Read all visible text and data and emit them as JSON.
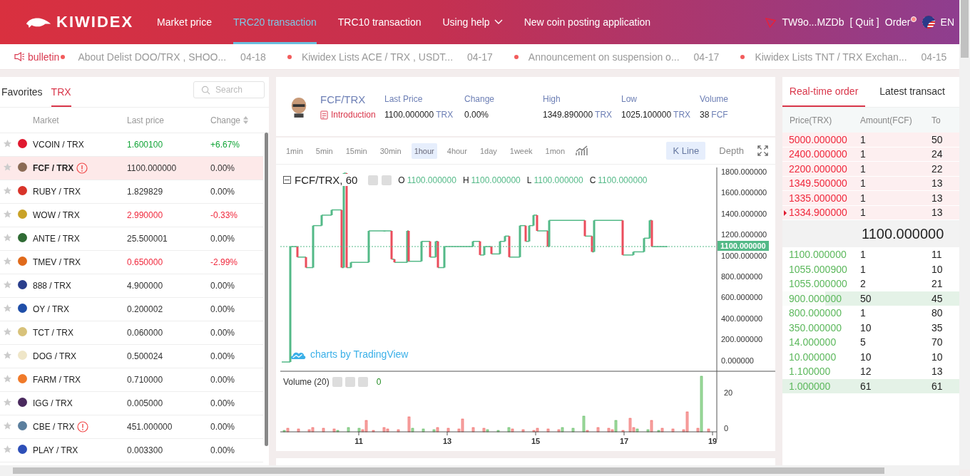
{
  "header": {
    "logo": "KIWIDEX",
    "nav": [
      {
        "label": "Market price",
        "selected": false,
        "dropdown": false
      },
      {
        "label": "TRC20 transaction",
        "selected": true,
        "dropdown": false
      },
      {
        "label": "TRC10 transaction",
        "selected": false,
        "dropdown": false
      },
      {
        "label": "Using help",
        "selected": false,
        "dropdown": true
      },
      {
        "label": "New coin posting application",
        "selected": false,
        "dropdown": false
      }
    ],
    "account": "TW9o...MZDb",
    "quit": "[ Quit ]",
    "order": "Order",
    "language": "EN"
  },
  "ticker": {
    "label": "bulletin",
    "items": [
      {
        "text": "About Delist DOO/TRX , SHOO...",
        "date": "04-18"
      },
      {
        "text": "Kiwidex Lists ACE / TRX , USDT...",
        "date": "04-17"
      },
      {
        "text": "Announcement on suspension o...",
        "date": "04-17"
      },
      {
        "text": "Kiwidex Lists TNT / TRX Exchan...",
        "date": "04-15"
      }
    ]
  },
  "markets": {
    "tabs": [
      {
        "label": "Favorites",
        "selected": false
      },
      {
        "label": "TRX",
        "selected": true
      }
    ],
    "search": {
      "placeholder": "Search"
    },
    "columns": [
      "Market",
      "Last price",
      "Change"
    ],
    "rows": [
      {
        "market": "VCOIN / TRX",
        "price": "1.600100",
        "change": "+6.67%",
        "kind": "up",
        "warning": false,
        "selected": false,
        "color": "#e0192f"
      },
      {
        "market": "FCF / TRX",
        "price": "1100.000000",
        "change": "0.00%",
        "kind": "flat",
        "warning": true,
        "selected": true,
        "color": "#8a6b55"
      },
      {
        "market": "RUBY / TRX",
        "price": "1.829829",
        "change": "0.00%",
        "kind": "flat",
        "warning": false,
        "selected": false,
        "color": "#d8342a"
      },
      {
        "market": "WOW / TRX",
        "price": "2.990000",
        "change": "-0.33%",
        "kind": "down",
        "warning": false,
        "selected": false,
        "color": "#c9a227"
      },
      {
        "market": "ANTE / TRX",
        "price": "25.500001",
        "change": "0.00%",
        "kind": "flat",
        "warning": false,
        "selected": false,
        "color": "#2f6b34"
      },
      {
        "market": "TMEV / TRX",
        "price": "0.650000",
        "change": "-2.99%",
        "kind": "down",
        "warning": false,
        "selected": false,
        "color": "#e06a1b"
      },
      {
        "market": "888 / TRX",
        "price": "4.900000",
        "change": "0.00%",
        "kind": "flat",
        "warning": false,
        "selected": false,
        "color": "#2a3e8c"
      },
      {
        "market": "OY / TRX",
        "price": "0.200002",
        "change": "0.00%",
        "kind": "flat",
        "warning": false,
        "selected": false,
        "color": "#1f4ea8"
      },
      {
        "market": "TCT / TRX",
        "price": "0.060000",
        "change": "0.00%",
        "kind": "flat",
        "warning": false,
        "selected": false,
        "color": "#d8c27a"
      },
      {
        "market": "DOG / TRX",
        "price": "0.500024",
        "change": "0.00%",
        "kind": "flat",
        "warning": false,
        "selected": false,
        "color": "#efe6c8"
      },
      {
        "market": "FARM / TRX",
        "price": "0.710000",
        "change": "0.00%",
        "kind": "flat",
        "warning": false,
        "selected": false,
        "color": "#f07a2a"
      },
      {
        "market": "IGG / TRX",
        "price": "0.005000",
        "change": "0.00%",
        "kind": "flat",
        "warning": false,
        "selected": false,
        "color": "#4a2a5e"
      },
      {
        "market": "CBE / TRX",
        "price": "451.000000",
        "change": "0.00%",
        "kind": "flat",
        "warning": true,
        "selected": false,
        "color": "#5b7f9e"
      },
      {
        "market": "PLAY / TRX",
        "price": "0.003300",
        "change": "0.00%",
        "kind": "flat",
        "warning": false,
        "selected": false,
        "color": "#2d4fb8"
      }
    ]
  },
  "pair": {
    "name": "FCF/TRX",
    "intro": "Introduction",
    "stats": [
      {
        "label": "Last Price",
        "value": "1100.000000",
        "unit": "TRX"
      },
      {
        "label": "Change",
        "value": "0.00%"
      },
      {
        "label": "High",
        "value": "1349.890000",
        "unit": "TRX"
      },
      {
        "label": "Low",
        "value": "1025.100000",
        "unit": "TRX"
      },
      {
        "label": "Volume",
        "value": "38",
        "unit": "FCF"
      }
    ]
  },
  "chart": {
    "intervals": [
      {
        "label": "1min",
        "selected": false
      },
      {
        "label": "5min",
        "selected": false
      },
      {
        "label": "15min",
        "selected": false
      },
      {
        "label": "30min",
        "selected": false
      },
      {
        "label": "1hour",
        "selected": true
      },
      {
        "label": "4hour",
        "selected": false
      },
      {
        "label": "1day",
        "selected": false
      },
      {
        "label": "1week",
        "selected": false
      },
      {
        "label": "1mon",
        "selected": false
      }
    ],
    "views": [
      {
        "label": "K Line",
        "selected": true
      },
      {
        "label": "Depth",
        "selected": false
      }
    ],
    "legend": {
      "title": "FCF/TRX, 60",
      "values": [
        {
          "key": "O",
          "value": "1100.000000"
        },
        {
          "key": "H",
          "value": "1100.000000"
        },
        {
          "key": "L",
          "value": "1100.000000"
        },
        {
          "key": "C",
          "value": "1100.000000"
        }
      ]
    },
    "price_ticks": [
      "1800.000000",
      "1600.000000",
      "1400.000000",
      "1200.000000",
      "1000.000000",
      "800.000000",
      "600.000000",
      "400.000000",
      "200.000000",
      "0.000000"
    ],
    "last_tag": "1100.000000",
    "watermark": "charts by TradingView",
    "volume": {
      "title": "Volume (20)",
      "value": "0",
      "ticks": [
        "20",
        "0"
      ]
    },
    "date_ticks": [
      "11",
      "13",
      "15",
      "17",
      "19"
    ]
  },
  "orderbook": {
    "tabs": [
      {
        "label": "Real-time order",
        "selected": true
      },
      {
        "label": "Latest transact",
        "selected": false
      }
    ],
    "columns": [
      "Price(TRX)",
      "Amount(FCF)",
      "To"
    ],
    "asks": [
      {
        "price": "5000.000000",
        "amount": "1",
        "total": "50",
        "pointer": false
      },
      {
        "price": "2400.000000",
        "amount": "1",
        "total": "24",
        "pointer": false
      },
      {
        "price": "2200.000000",
        "amount": "1",
        "total": "22",
        "pointer": false
      },
      {
        "price": "1349.500000",
        "amount": "1",
        "total": "13",
        "pointer": false
      },
      {
        "price": "1335.000000",
        "amount": "1",
        "total": "13",
        "pointer": false
      },
      {
        "price": "1334.900000",
        "amount": "1",
        "total": "13",
        "pointer": true
      }
    ],
    "mid": "1100.000000",
    "bids": [
      {
        "price": "1100.000000",
        "amount": "1",
        "total": "11"
      },
      {
        "price": "1055.000900",
        "amount": "1",
        "total": "10"
      },
      {
        "price": "1055.000000",
        "amount": "2",
        "total": "21"
      },
      {
        "price": "900.000000",
        "amount": "50",
        "total": "45",
        "level": 0.76
      },
      {
        "price": "800.000000",
        "amount": "1",
        "total": "80"
      },
      {
        "price": "350.000000",
        "amount": "10",
        "total": "35"
      },
      {
        "price": "14.000000",
        "amount": "5",
        "total": "70"
      },
      {
        "price": "10.000000",
        "amount": "10",
        "total": "10"
      },
      {
        "price": "1.100000",
        "amount": "12",
        "total": "13"
      },
      {
        "price": "1.000000",
        "amount": "61",
        "total": "61",
        "level": 1
      }
    ]
  }
}
